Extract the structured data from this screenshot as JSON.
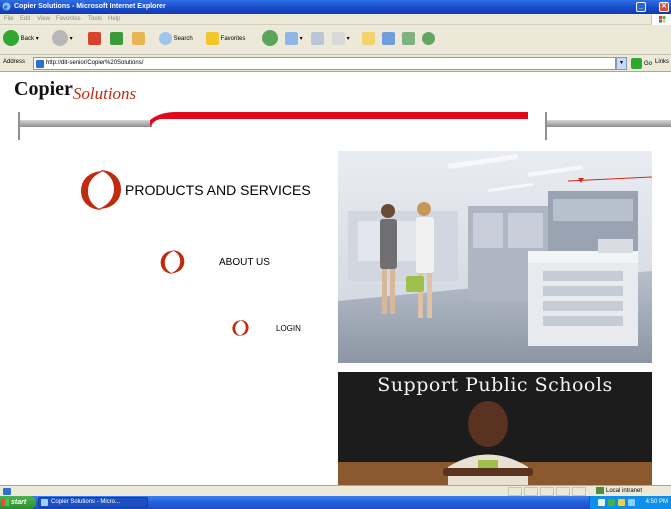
{
  "window": {
    "title": "Copier Solutions - Microsoft Internet Explorer",
    "minimize": "_",
    "restore": "▫",
    "close": "✕"
  },
  "menu": [
    "File",
    "Edit",
    "View",
    "Favorites",
    "Tools",
    "Help"
  ],
  "toolbar": {
    "back": "Back",
    "search": "Search",
    "favorites": "Favorites"
  },
  "address": {
    "label": "Address",
    "url": "http://dit-senior/Copier%20Solutions/",
    "go": "Go",
    "links": "Links"
  },
  "logo": {
    "copier": "Copier",
    "solutions": "Solutions"
  },
  "nav": {
    "products": "PRODUCTS AND SERVICES",
    "about": "ABOUT US",
    "login": "LOGIN"
  },
  "promo": {
    "chalkboard": "Support Public Schools"
  },
  "status": {
    "zone": "Local intranet"
  },
  "taskbar": {
    "start": "start",
    "window_item": "Copier Solutions - Micro...",
    "clock": "4:50 PM"
  },
  "colors": {
    "brand_red": "#c22a10",
    "banner_red": "#e0081a",
    "gray_bar": "#a7a7a7"
  }
}
